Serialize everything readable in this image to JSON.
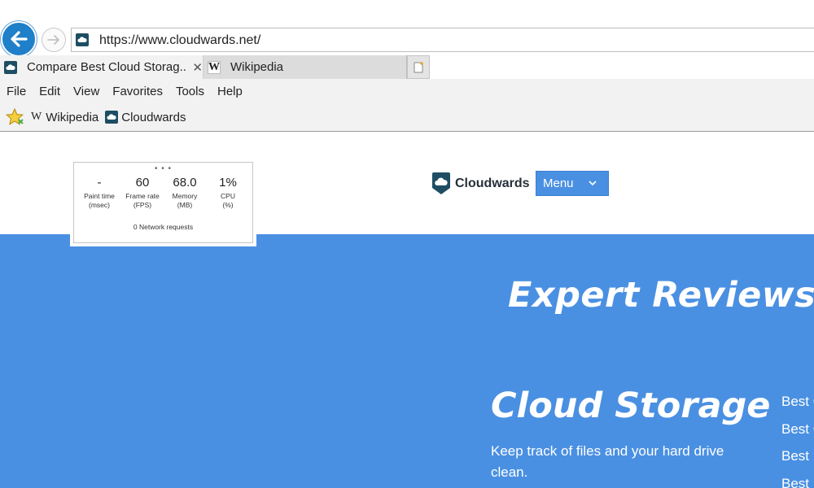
{
  "address_bar": {
    "url": "https://www.cloudwards.net/"
  },
  "tabs": [
    {
      "title": "Compare Best Cloud Storag...",
      "close": "✕",
      "active": true
    },
    {
      "title": "Wikipedia",
      "active": false
    }
  ],
  "menu_bar": {
    "items": [
      "File",
      "Edit",
      "View",
      "Favorites",
      "Tools",
      "Help"
    ]
  },
  "favorites_bar": {
    "items": [
      {
        "icon": "W",
        "label": "Wikipedia"
      },
      {
        "label": "Cloudwards"
      }
    ]
  },
  "perf_overlay": {
    "dots": "• • •",
    "metrics": [
      {
        "value": "-",
        "label": "Paint time",
        "unit": "(msec)"
      },
      {
        "value": "60",
        "label": "Frame rate",
        "unit": "(FPS)"
      },
      {
        "value": "68.0",
        "label": "Memory",
        "unit": "(MB)"
      },
      {
        "value": "1%",
        "label": "CPU",
        "unit": "(%)"
      }
    ],
    "network": "0  Network requests"
  },
  "site": {
    "logo_text": "Cloudwards",
    "menu_label": "Menu",
    "hero_title": "Expert Reviews. Sin",
    "section_title": "Cloud Storage",
    "section_desc": "Keep track of files and your hard drive clean.",
    "side_links": [
      "Best C",
      "Best C",
      "Best I",
      "Best"
    ]
  },
  "colors": {
    "hero_bg": "#4a90e2",
    "back_button": "#1f7fc9",
    "brand_dark": "#1d4e63"
  }
}
